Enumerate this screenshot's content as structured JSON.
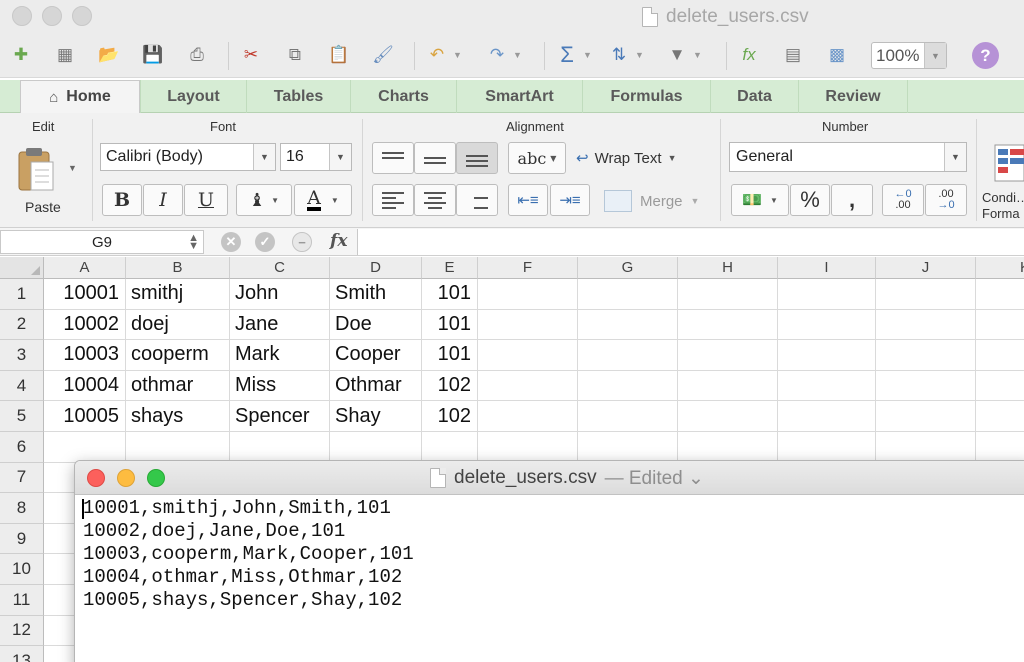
{
  "window": {
    "title": "delete_users.csv"
  },
  "toolbar": {
    "items": [
      "new-icon",
      "open-template-icon",
      "open-icon",
      "save-icon",
      "print-icon",
      "cut-icon",
      "copy-icon",
      "paste-icon",
      "format-painter-icon",
      "undo-icon",
      "redo-icon",
      "autosum-icon",
      "sort-icon",
      "filter-icon",
      "function-icon",
      "gallery-icon",
      "toolbox-icon"
    ],
    "zoom": "100%",
    "help": "?"
  },
  "tabs": [
    "Home",
    "Layout",
    "Tables",
    "Charts",
    "SmartArt",
    "Formulas",
    "Data",
    "Review"
  ],
  "ribbon": {
    "groups": {
      "edit": "Edit",
      "font": "Font",
      "alignment": "Alignment",
      "number": "Number"
    },
    "paste": "Paste",
    "font_name": "Calibri (Body)",
    "font_size": "16",
    "bold": "B",
    "italic": "I",
    "underline": "U",
    "font_color_letter": "A",
    "abc": "abc",
    "wrap_text": "Wrap Text",
    "merge": "Merge",
    "number_format": "General",
    "percent": "%",
    "comma": ",",
    "inc_decimal": ".00",
    "dec_decimal": ".00",
    "cond_format": "Condi…",
    "cond_format_line2": "Forma"
  },
  "formula_bar": {
    "name_box": "G9",
    "fx": "fx",
    "value": ""
  },
  "sheet": {
    "columns": [
      "A",
      "B",
      "C",
      "D",
      "E",
      "F",
      "G",
      "H",
      "I",
      "J",
      "K"
    ],
    "rows": [
      "1",
      "2",
      "3",
      "4",
      "5",
      "6",
      "7",
      "8",
      "9",
      "10",
      "11",
      "12",
      "13"
    ],
    "data": [
      [
        "10001",
        "smithj",
        "John",
        "Smith",
        "101"
      ],
      [
        "10002",
        "doej",
        "Jane",
        "Doe",
        "101"
      ],
      [
        "10003",
        "cooperm",
        "Mark",
        "Cooper",
        "101"
      ],
      [
        "10004",
        "othmar",
        "Miss",
        "Othmar",
        "102"
      ],
      [
        "10005",
        "shays",
        "Spencer",
        "Shay",
        "102"
      ]
    ],
    "selected_cell": "G9"
  },
  "textedit": {
    "title": "delete_users.csv",
    "status": "— Edited ⌄",
    "lines": [
      "10001,smithj,John,Smith,101",
      "10002,doej,Jane,Doe,101",
      "10003,cooperm,Mark,Cooper,101",
      "10004,othmar,Miss,Othmar,102",
      "10005,shays,Spencer,Shay,102"
    ],
    "traffic_colors": {
      "close": "#fc605c",
      "minimize": "#fdbc40",
      "zoom": "#34c84a"
    }
  }
}
